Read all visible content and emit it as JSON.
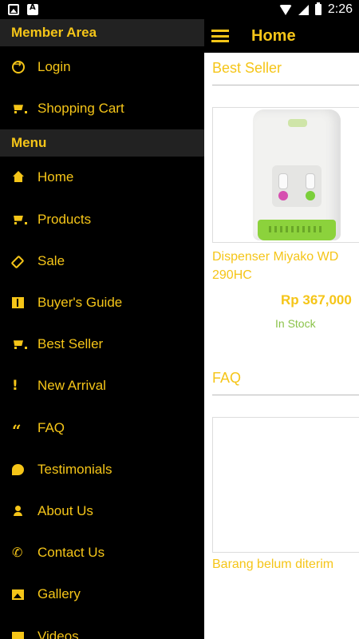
{
  "status_bar": {
    "time": "2:26"
  },
  "app_bar": {
    "title": "Home"
  },
  "main": {
    "best_seller_title": "Best Seller",
    "product": {
      "name_line1": "Dispenser Miyako WD",
      "name_line2": "290HC",
      "price": "Rp 367,000",
      "stock": "In Stock"
    },
    "faq_title": "FAQ",
    "faq_item": "Barang belum diterim"
  },
  "drawer": {
    "member_header": "Member Area",
    "member_items": [
      {
        "label": "Login",
        "icon": "login-icon"
      },
      {
        "label": "Shopping Cart",
        "icon": "cart-icon"
      }
    ],
    "menu_header": "Menu",
    "menu_items": [
      {
        "label": "Home",
        "icon": "home-icon"
      },
      {
        "label": "Products",
        "icon": "cart-icon"
      },
      {
        "label": "Sale",
        "icon": "tag-icon"
      },
      {
        "label": "Buyer's Guide",
        "icon": "book-icon"
      },
      {
        "label": "Best Seller",
        "icon": "cart-icon"
      },
      {
        "label": "New Arrival",
        "icon": "exclamation-icon"
      },
      {
        "label": "FAQ",
        "icon": "quote-icon"
      },
      {
        "label": "Testimonials",
        "icon": "chat-icon"
      },
      {
        "label": "About Us",
        "icon": "person-icon"
      },
      {
        "label": "Contact Us",
        "icon": "phone-icon"
      },
      {
        "label": "Gallery",
        "icon": "image-icon"
      },
      {
        "label": "Videos",
        "icon": "video-icon"
      }
    ]
  },
  "colors": {
    "accent": "#f5c518",
    "stock": "#8bc34a",
    "drawer_bg": "#000000",
    "header_bg": "#222222"
  }
}
